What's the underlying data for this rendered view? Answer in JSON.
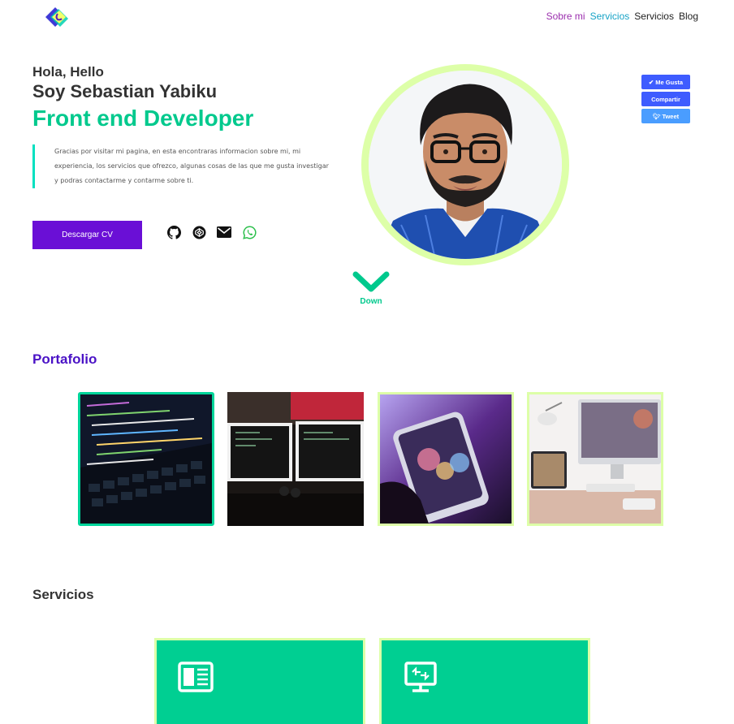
{
  "nav": {
    "items": [
      {
        "label": "Sobre mi",
        "color": "#9b2fae"
      },
      {
        "label": "Servicios",
        "color": "#17a3c6"
      },
      {
        "label": "Servicios",
        "color": "#222222"
      },
      {
        "label": "Blog",
        "color": "#222222"
      }
    ]
  },
  "hero": {
    "greeting": "Hola, Hello",
    "name": "Soy Sebastian Yabiku",
    "role": "Front end Developer",
    "intro": "Gracias por visitar mi pagina, en esta encontraras informacion sobre mi, mi experiencia, los servicios que ofrezco, algunas cosas de las que me gusta investigar y podras contactarme y contarme sobre ti.",
    "cv_button": "Descargar CV",
    "down_label": "Down"
  },
  "share": {
    "like": "Me Gusta",
    "share": "Compartir",
    "tweet": "Tweet"
  },
  "portfolio": {
    "title": "Portafolio"
  },
  "services": {
    "title": "Servicios"
  },
  "colors": {
    "accent_green": "#00c98d",
    "accent_purple": "#6a0fd6",
    "lime_border": "#ddffa8",
    "facebook_blue": "#3e5cff"
  }
}
